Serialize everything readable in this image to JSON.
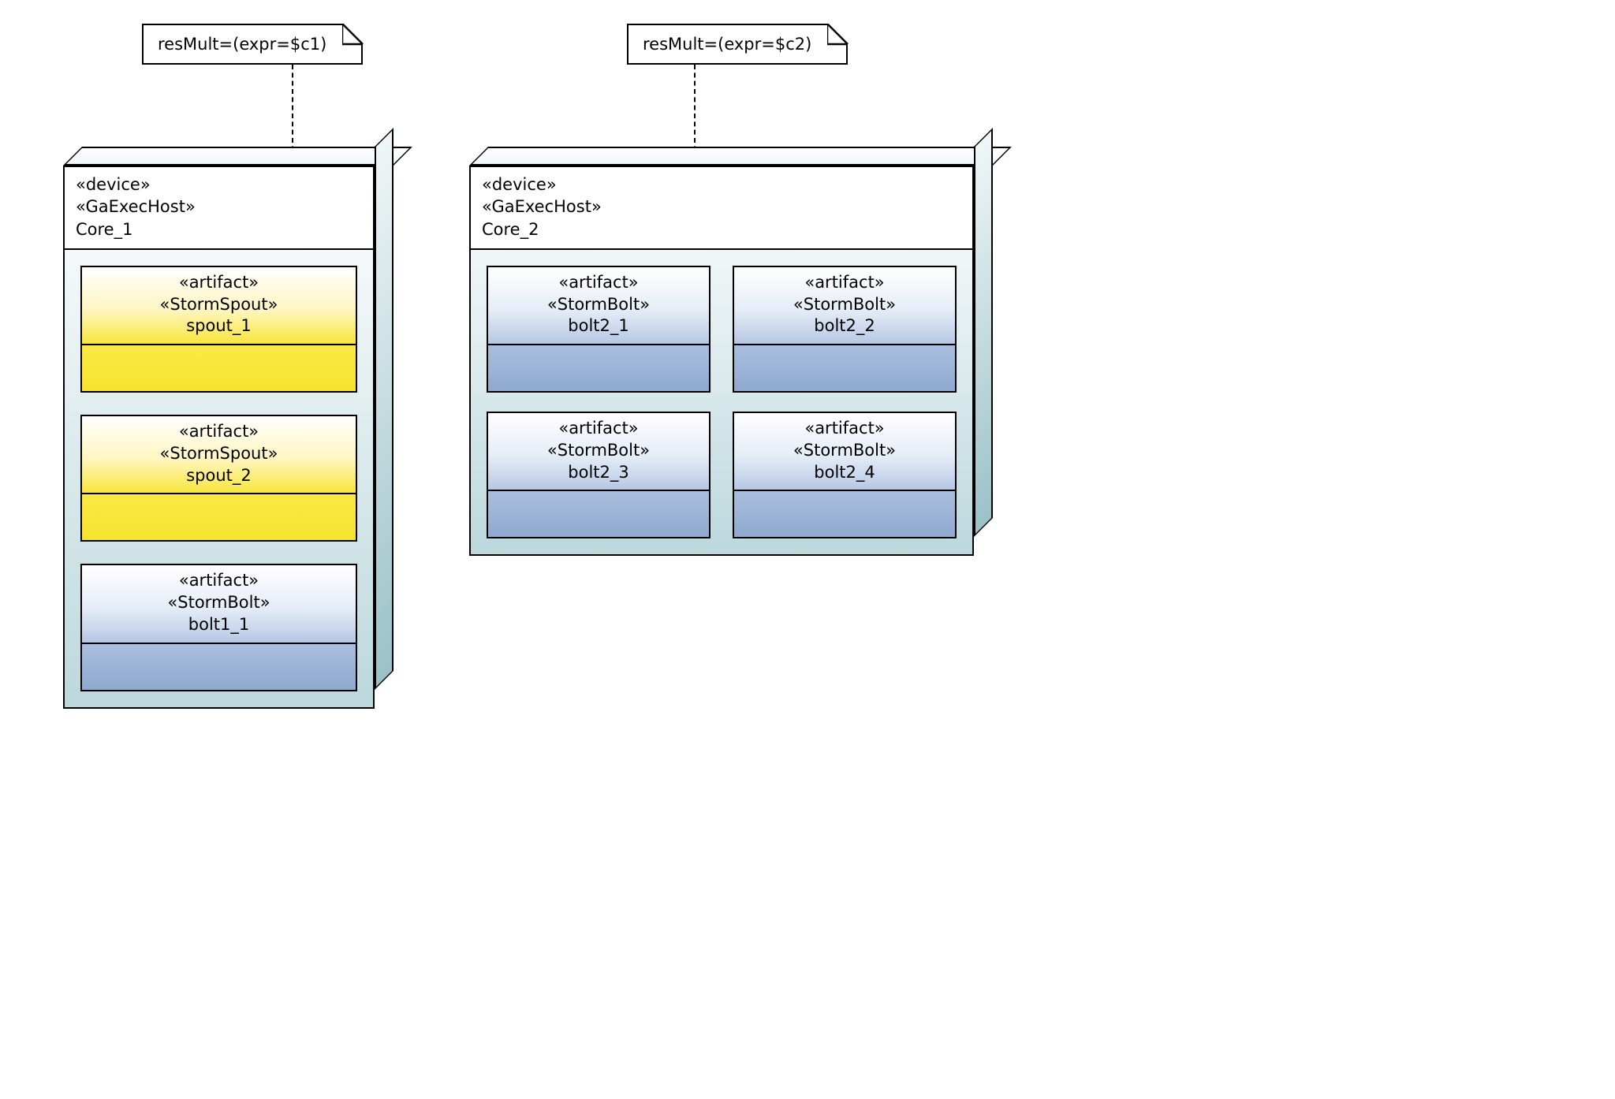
{
  "notes": {
    "left": "resMult=(expr=$c1)",
    "right": "resMult=(expr=$c2)"
  },
  "stereotypes": {
    "device": "«device»",
    "host": "«GaExecHost»",
    "artifact": "«artifact»",
    "spout": "«StormSpout»",
    "bolt": "«StormBolt»"
  },
  "cores": {
    "core1": {
      "name": "Core_1",
      "artifacts": [
        {
          "kind": "spout",
          "name": "spout_1"
        },
        {
          "kind": "spout",
          "name": "spout_2"
        },
        {
          "kind": "bolt",
          "name": "bolt1_1"
        }
      ]
    },
    "core2": {
      "name": "Core_2",
      "artifacts": [
        {
          "kind": "bolt",
          "name": "bolt2_1"
        },
        {
          "kind": "bolt",
          "name": "bolt2_2"
        },
        {
          "kind": "bolt",
          "name": "bolt2_3"
        },
        {
          "kind": "bolt",
          "name": "bolt2_4"
        }
      ]
    }
  }
}
